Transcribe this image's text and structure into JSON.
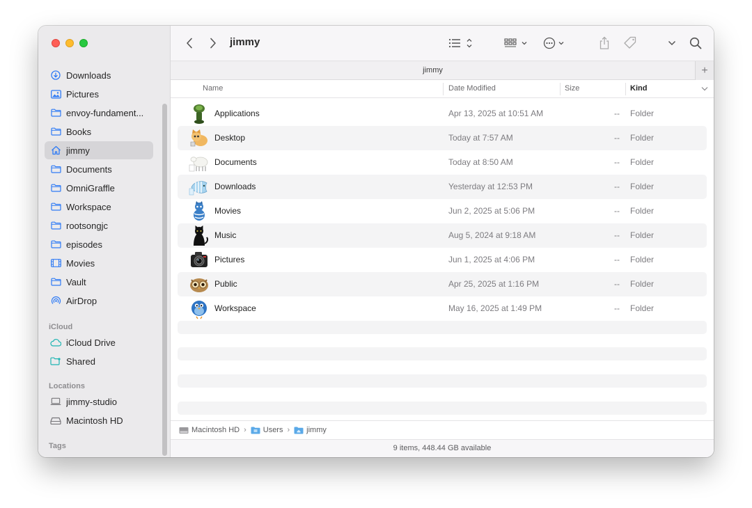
{
  "window": {
    "title": "jimmy",
    "tab_title": "jimmy"
  },
  "sidebar": {
    "favorites": [
      {
        "label": "Downloads",
        "icon": "download-circle-icon"
      },
      {
        "label": "Pictures",
        "icon": "photo-icon"
      },
      {
        "label": "envoy-fundament...",
        "icon": "folder-icon"
      },
      {
        "label": "Books",
        "icon": "folder-icon"
      },
      {
        "label": "jimmy",
        "icon": "home-icon",
        "active": true
      },
      {
        "label": "Documents",
        "icon": "folder-icon"
      },
      {
        "label": "OmniGraffle",
        "icon": "folder-icon"
      },
      {
        "label": "Workspace",
        "icon": "folder-icon"
      },
      {
        "label": "rootsongjc",
        "icon": "folder-icon"
      },
      {
        "label": "episodes",
        "icon": "folder-icon"
      },
      {
        "label": "Movies",
        "icon": "film-icon"
      },
      {
        "label": "Vault",
        "icon": "folder-icon"
      },
      {
        "label": "AirDrop",
        "icon": "airdrop-icon"
      }
    ],
    "icloud_heading": "iCloud",
    "icloud": [
      {
        "label": "iCloud Drive",
        "icon": "cloud-icon"
      },
      {
        "label": "Shared",
        "icon": "shared-folder-icon"
      }
    ],
    "locations_heading": "Locations",
    "locations": [
      {
        "label": "jimmy-studio",
        "icon": "laptop-icon"
      },
      {
        "label": "Macintosh HD",
        "icon": "disk-icon"
      }
    ],
    "tags_heading": "Tags"
  },
  "columns": {
    "name": "Name",
    "date": "Date Modified",
    "size": "Size",
    "kind": "Kind"
  },
  "files": [
    {
      "name": "Applications",
      "date": "Apr 13, 2025 at 10:51 AM",
      "size": "--",
      "kind": "Folder",
      "icon": "applications-folder-icon"
    },
    {
      "name": "Desktop",
      "date": "Today at 7:57 AM",
      "size": "--",
      "kind": "Folder",
      "icon": "cat-desktop-icon"
    },
    {
      "name": "Documents",
      "date": "Today at 8:50 AM",
      "size": "--",
      "kind": "Folder",
      "icon": "sheep-documents-icon"
    },
    {
      "name": "Downloads",
      "date": "Yesterday at 12:53 PM",
      "size": "--",
      "kind": "Folder",
      "icon": "fish-downloads-icon"
    },
    {
      "name": "Movies",
      "date": "Jun 2, 2025 at 5:06 PM",
      "size": "--",
      "kind": "Folder",
      "icon": "cat-movies-icon"
    },
    {
      "name": "Music",
      "date": "Aug 5, 2024 at 9:18 AM",
      "size": "--",
      "kind": "Folder",
      "icon": "black-cat-music-icon"
    },
    {
      "name": "Pictures",
      "date": "Jun 1, 2025 at 4:06 PM",
      "size": "--",
      "kind": "Folder",
      "icon": "camera-pictures-icon"
    },
    {
      "name": "Public",
      "date": "Apr 25, 2025 at 1:16 PM",
      "size": "--",
      "kind": "Folder",
      "icon": "owl-public-icon"
    },
    {
      "name": "Workspace",
      "date": "May 16, 2025 at 1:49 PM",
      "size": "--",
      "kind": "Folder",
      "icon": "bird-workspace-icon"
    }
  ],
  "path": [
    "Macintosh HD",
    "Users",
    "jimmy"
  ],
  "status": "9 items, 448.44 GB available",
  "colors": {
    "accent": "#2f7bf5",
    "sidebar_bg": "#ebeaec",
    "row_alt": "#f4f4f5"
  }
}
